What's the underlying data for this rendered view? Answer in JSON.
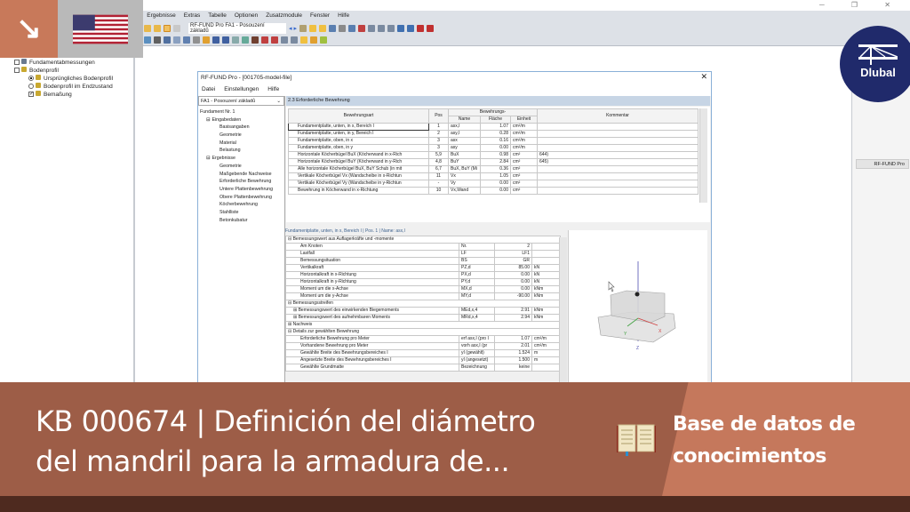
{
  "app": {
    "menu": [
      "...ung",
      "Ergebnisse",
      "Extras",
      "Tabelle",
      "Optionen",
      "Zusatzmodule",
      "Fenster",
      "Hilfe"
    ],
    "toolbar_combo": "RF-FUND Pro FA1 - Posouzení základů"
  },
  "navigator": {
    "items": [
      {
        "label": "Fundamentabmessungen",
        "level": 0
      },
      {
        "label": "Bodenprofil",
        "level": 0
      },
      {
        "label": "Ursprüngliches Bodenprofil",
        "level": 1,
        "type": "radio",
        "checked": true
      },
      {
        "label": "Bodenprofil im Endzustand",
        "level": 1,
        "type": "radio",
        "checked": false
      },
      {
        "label": "Bemaßung",
        "level": 1,
        "type": "check",
        "checked": true
      }
    ]
  },
  "dialog": {
    "title": "RF-FUND Pro - [001705-model-file]",
    "menu": [
      "Datei",
      "Einstellungen",
      "Hilfe"
    ],
    "case_select": "FA1 - Posouzení základů",
    "tree": [
      {
        "label": "Fundament Nr. 1",
        "l": 0
      },
      {
        "label": "Eingabedaten",
        "l": 1
      },
      {
        "label": "Basisangaben",
        "l": 2
      },
      {
        "label": "Geometrie",
        "l": 2
      },
      {
        "label": "Material",
        "l": 2
      },
      {
        "label": "Belastung",
        "l": 2
      },
      {
        "label": "Ergebnisse",
        "l": 1
      },
      {
        "label": "Geometrie",
        "l": 2
      },
      {
        "label": "Maßgebende Nachweise",
        "l": 2
      },
      {
        "label": "Erforderliche Bewehrung",
        "l": 2
      },
      {
        "label": "Untere Plattenbewehrung",
        "l": 2
      },
      {
        "label": "Obere Plattenbewehrung",
        "l": 2
      },
      {
        "label": "Köcherbewehrung",
        "l": 2
      },
      {
        "label": "Stahlliste",
        "l": 2
      },
      {
        "label": "Betonkubatur",
        "l": 2
      }
    ],
    "section_title": "2.3 Erforderliche Bewehrung",
    "table": {
      "group_header": "Bewehrungs-",
      "headers": [
        "Bewehrungsart",
        "Pos",
        "Name",
        "Fläche",
        "Einheit",
        "Kommentar"
      ],
      "rows": [
        [
          "Fundamentplatte, unten, in x, Bereich I",
          "1",
          "asx,I",
          "1.07",
          "cm²/m",
          ""
        ],
        [
          "Fundamentplatte, unten, in y, Bereich I",
          "2",
          "asy,I",
          "0.28",
          "cm²/m",
          ""
        ],
        [
          "Fundamentplatte, oben, in x",
          "3",
          "asx",
          "0.16",
          "cm²/m",
          ""
        ],
        [
          "Fundamentplatte, oben, in y",
          "3",
          "asy",
          "0.00",
          "cm²/m",
          ""
        ],
        [
          "Horizontale Köcherbügel BuX (Köcherwand in x-Rich",
          "5,9",
          "BuX",
          "0.98",
          "cm²",
          "644)"
        ],
        [
          "Horizontale Köcherbügel BuY (Köcherwand in y-Rich",
          "4,8",
          "BuY",
          "2.84",
          "cm²",
          "645)"
        ],
        [
          "Alle horizontale Köcherbügel BuX, BuY Schub (in mit",
          "6,7",
          "BuX, BuY (Mi",
          "0.36",
          "cm²",
          ""
        ],
        [
          "Vertikale Köcherbügel Vx (Wandscheibe in x-Richtun",
          "11",
          "Vx",
          "1.05",
          "cm²",
          ""
        ],
        [
          "Vertikale Köcherbügel Vy (Wandscheibe in y-Richtun",
          "-",
          "Vy",
          "0.00",
          "cm²",
          ""
        ],
        [
          "Bewehrung in Köcherwand in x-Richtung",
          "10",
          "Vx,Wand",
          "0.00",
          "cm²",
          ""
        ]
      ]
    },
    "detail": {
      "label": "Fundamentplatte, unten, in x, Bereich I | Pos. 1 | Name: asx,I",
      "rows": [
        {
          "t": "g",
          "text": "⊟ Bemessungswert aus Auflagerkräfte und -momente"
        },
        {
          "t": "r",
          "d": "Am Knoten",
          "s": "Nr.",
          "v": "2",
          "u": ""
        },
        {
          "t": "r",
          "d": "Lastfall",
          "s": "LF",
          "v": "LF1",
          "u": ""
        },
        {
          "t": "r",
          "d": "Bemessungsituation",
          "s": "BS",
          "v": "GR",
          "u": ""
        },
        {
          "t": "r",
          "d": "Vertikalkraft",
          "s": "PZ,d",
          "v": "85.00",
          "u": "kN"
        },
        {
          "t": "r",
          "d": "Horizontalkraft in x-Richtung",
          "s": "PX,d",
          "v": "0.00",
          "u": "kN"
        },
        {
          "t": "r",
          "d": "Horizontalkraft in y-Richtung",
          "s": "PY,d",
          "v": "0.00",
          "u": "kN"
        },
        {
          "t": "r",
          "d": "Moment um die x-Achse",
          "s": "MX,d",
          "v": "0.00",
          "u": "kNm"
        },
        {
          "t": "r",
          "d": "Moment um die y-Achse",
          "s": "MY,d",
          "v": "-90.00",
          "u": "kNm"
        },
        {
          "t": "g",
          "text": "⊟ Bemessungsstreifen"
        },
        {
          "t": "r",
          "d": "⊞ Bemessungswert des einwirkenden Biegemoments",
          "s": "MEd,x,4",
          "v": "2.91",
          "u": "kNm"
        },
        {
          "t": "r",
          "d": "⊞ Bemessungswert des aufnehmbaren Moments",
          "s": "MRd,x,4",
          "v": "2.94",
          "u": "kNm"
        },
        {
          "t": "g",
          "text": "⊞ Nachweis"
        },
        {
          "t": "g",
          "text": "⊟ Details zur gewählten Bewehrung"
        },
        {
          "t": "r",
          "d": "Erforderliche Bewehrung pro Meter",
          "s": "erf asx,I (pro I",
          "v": "1.07",
          "u": "cm²/m"
        },
        {
          "t": "r",
          "d": "Vorhandene Bewehrung pro Meter",
          "s": "vorh asx,I (pr",
          "v": "2.01",
          "u": "cm²/m"
        },
        {
          "t": "r",
          "d": "Gewählte Breite des Bewehrungsbereiches I",
          "s": "yI (gewählt)",
          "v": "1.524",
          "u": "m"
        },
        {
          "t": "r",
          "d": "Angesetzte Breite des Bewehrungsbereiches I",
          "s": "yI (angesetzt)",
          "v": "1.500",
          "u": "m"
        },
        {
          "t": "r",
          "d": "Gewählte Grundmatte",
          "s": "Bezeichnung",
          "v": "keine",
          "u": ""
        }
      ]
    },
    "view_axes": {
      "x": "X",
      "y": "Y",
      "z": "Z"
    }
  },
  "right_panel": {
    "button": "RF-FUND Pro"
  },
  "logo": {
    "text": "Dlubal"
  },
  "banner": {
    "title_line1": "KB 000674 | Definición del diámetro",
    "title_line2": "del mandril para la armadura de...",
    "category": "Base de datos de conocimientos",
    "colors": {
      "left": "#9d5d47",
      "right": "#c5785c",
      "bottom": "#4e2a1f"
    }
  }
}
